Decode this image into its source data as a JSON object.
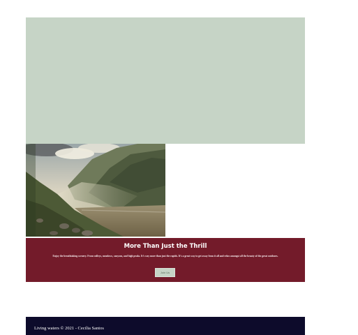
{
  "colors": {
    "hero_background": "#c6d4c6",
    "promo_background": "#731b2a",
    "button_background": "#c6d4c6",
    "footer_background": "#0d0b2b"
  },
  "photo": {
    "icon": "mountain-valley-photo"
  },
  "promo": {
    "title": "More Than Just the Thrill",
    "text": "Enjoy the breathtaking scenery. From valleys, meadows, canyons, and high peaks. It’s way more than just the rapids. It’s a great way to get away from it all and relax amongst all the beauty of the great outdoors.",
    "button_label": "Join Us"
  },
  "footer": {
    "text": "Living waters © 2021 - Cecilia Santos"
  }
}
